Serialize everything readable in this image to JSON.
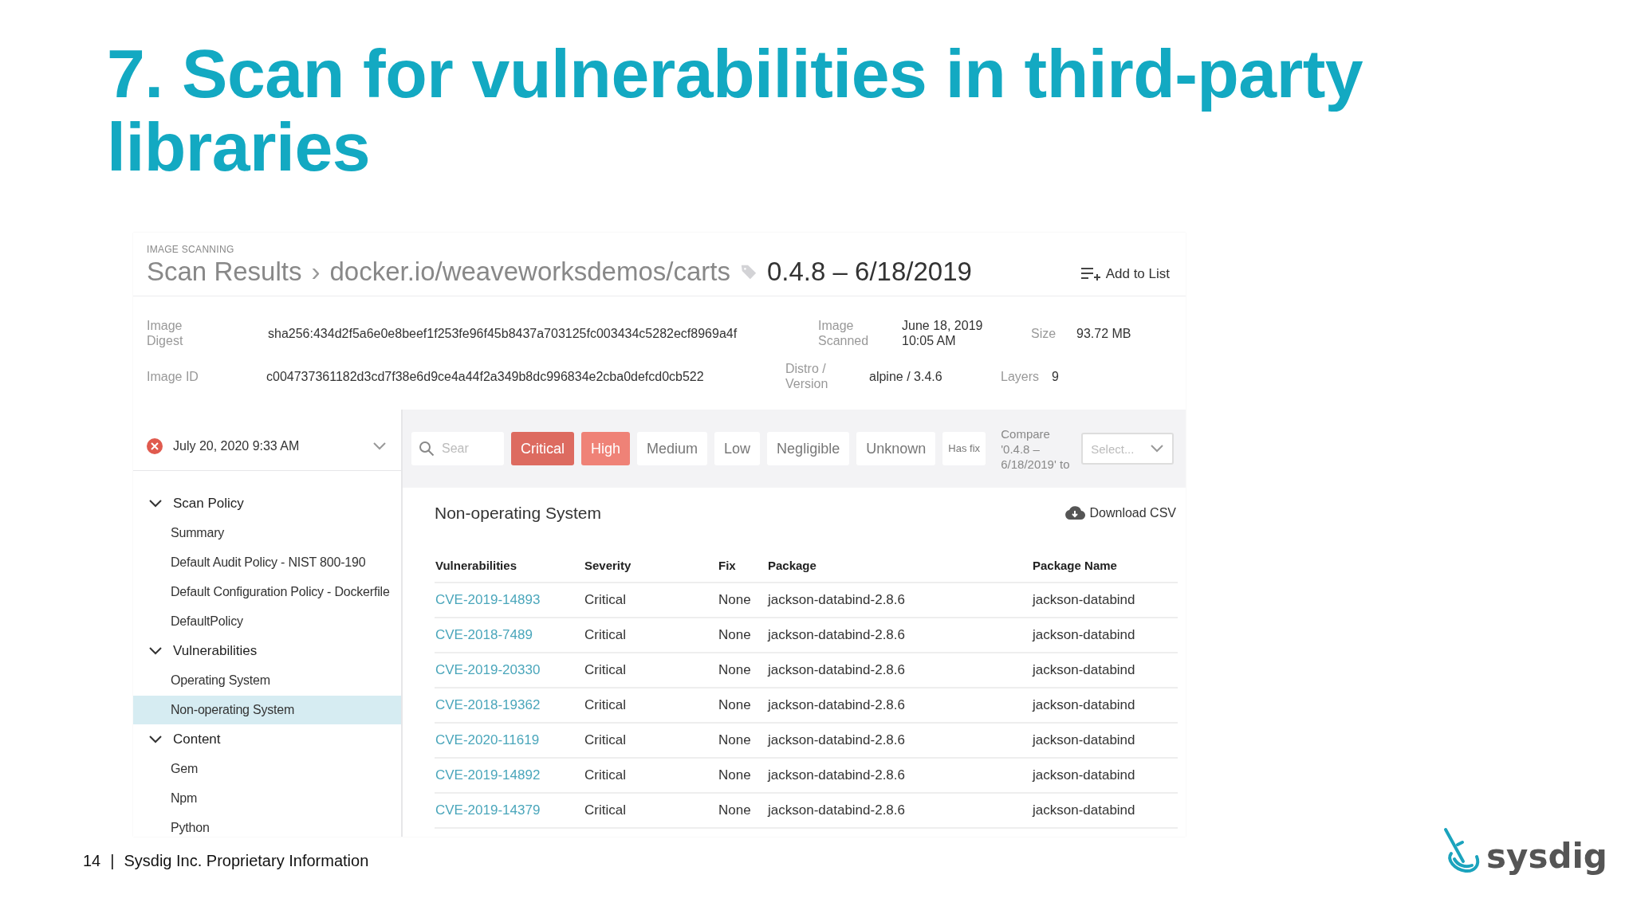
{
  "slide_title": "7. Scan for vulnerabilities in third-party libraries",
  "app": {
    "section": "IMAGE SCANNING",
    "breadcrumb": {
      "root": "Scan Results",
      "separator": "›",
      "image": "docker.io/weaveworksdemos/carts",
      "tag": "0.4.8 – 6/18/2019"
    },
    "add_button": "Add to List",
    "info_rows": [
      {
        "fields": [
          {
            "label": "Image Digest",
            "value": "sha256:434d2f5a6e0e8beef1f253fe96f45b8437a703125fc003434c5282ecf8969a4f"
          },
          {
            "label": "Image Scanned",
            "value": "June 18, 2019 10:05 AM"
          },
          {
            "label": "Size",
            "value": "93.72 MB"
          }
        ]
      },
      {
        "fields": [
          {
            "label": "Image ID",
            "value": "c004737361182d3cd7f38e6d9ce4a44f2a349b8dc996834e2cba0defcd0cb522"
          },
          {
            "label": "Distro / Version",
            "value": "alpine / 3.4.6"
          },
          {
            "label": "Layers",
            "value": "9"
          }
        ]
      }
    ],
    "scan_select": {
      "failed": true,
      "value": "July 20, 2020 9:33 AM"
    },
    "tree": [
      {
        "label": "Scan Policy",
        "expanded": true,
        "selected": false,
        "children": [
          {
            "label": "Summary",
            "selected": false
          },
          {
            "label": "Default Audit Policy - NIST 800-190",
            "selected": false
          },
          {
            "label": "Default Configuration Policy - Dockerfile",
            "selected": false
          },
          {
            "label": "DefaultPolicy",
            "selected": false
          }
        ]
      },
      {
        "label": "Vulnerabilities",
        "expanded": true,
        "selected": false,
        "children": [
          {
            "label": "Operating System",
            "selected": false
          },
          {
            "label": "Non-operating System",
            "selected": true
          }
        ]
      },
      {
        "label": "Content",
        "expanded": true,
        "selected": false,
        "children": [
          {
            "label": "Gem",
            "selected": false
          },
          {
            "label": "Npm",
            "selected": false
          },
          {
            "label": "Python",
            "selected": false
          }
        ]
      }
    ],
    "search": {
      "placeholder": "Sear"
    },
    "filters": [
      {
        "label": "Critical",
        "selected": true,
        "color": "#dd6b60"
      },
      {
        "label": "High",
        "selected": true,
        "color": "#ef8277"
      },
      {
        "label": "Medium",
        "selected": false
      },
      {
        "label": "Low",
        "selected": false
      },
      {
        "label": "Negligible",
        "selected": false
      },
      {
        "label": "Unknown",
        "selected": false
      },
      {
        "label": "Has fix",
        "selected": false
      }
    ],
    "compare_label": "Compare '0.4.8 – 6/18/2019' to",
    "compare_select": {
      "placeholder": "Select..."
    },
    "panel_title": "Non-operating System",
    "download_button": "Download CSV",
    "table": {
      "columns": [
        "Vulnerabilities",
        "Severity",
        "Fix",
        "Package",
        "Package Name"
      ],
      "rows": [
        [
          "CVE-2019-14893",
          "Critical",
          "None",
          "jackson-databind-2.8.6",
          "jackson-databind"
        ],
        [
          "CVE-2018-7489",
          "Critical",
          "None",
          "jackson-databind-2.8.6",
          "jackson-databind"
        ],
        [
          "CVE-2019-20330",
          "Critical",
          "None",
          "jackson-databind-2.8.6",
          "jackson-databind"
        ],
        [
          "CVE-2018-19362",
          "Critical",
          "None",
          "jackson-databind-2.8.6",
          "jackson-databind"
        ],
        [
          "CVE-2020-11619",
          "Critical",
          "None",
          "jackson-databind-2.8.6",
          "jackson-databind"
        ],
        [
          "CVE-2019-14892",
          "Critical",
          "None",
          "jackson-databind-2.8.6",
          "jackson-databind"
        ],
        [
          "CVE-2019-14379",
          "Critical",
          "None",
          "jackson-databind-2.8.6",
          "jackson-databind"
        ]
      ]
    }
  },
  "footer": {
    "page": "14",
    "separator": "|",
    "text": "Sysdig Inc. Proprietary Information"
  },
  "logo": {
    "text": "sysdig"
  }
}
